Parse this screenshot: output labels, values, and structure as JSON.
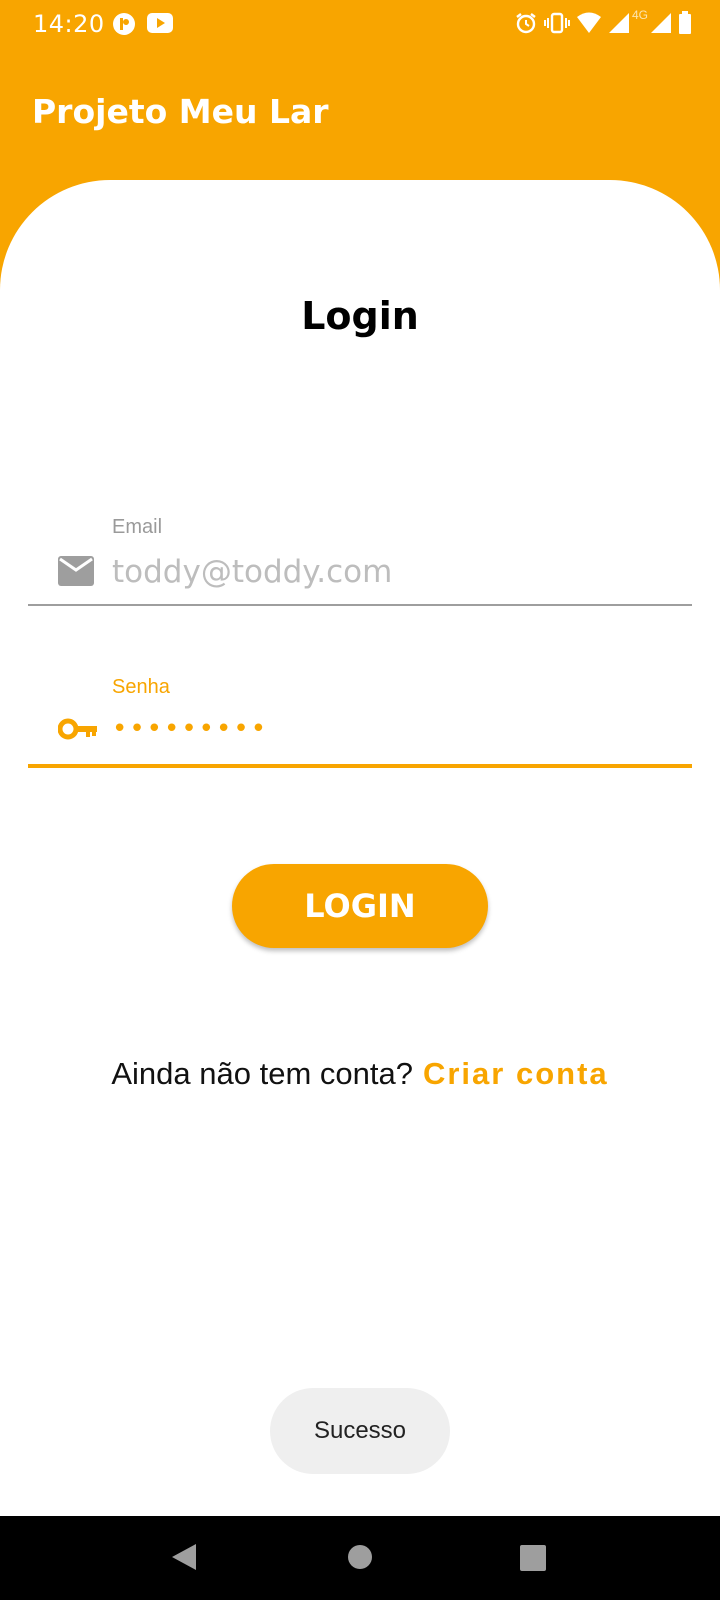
{
  "status_bar": {
    "time": "14:20",
    "left_icons": [
      "notification-app-icon",
      "youtube-icon"
    ],
    "right_icons": [
      "alarm-icon",
      "vibrate-icon",
      "wifi-icon",
      "signal-icon",
      "signal-icon",
      "battery-icon"
    ],
    "network_label": "4G"
  },
  "app_bar": {
    "title": "Projeto Meu Lar"
  },
  "login": {
    "heading": "Login",
    "email": {
      "label": "Email",
      "placeholder": "toddy@toddy.com",
      "value": ""
    },
    "password": {
      "label": "Senha",
      "value": "•••••••••"
    },
    "login_button_label": "LOGIN",
    "signup_prompt": "Ainda não tem conta?",
    "signup_link_label": "Criar conta"
  },
  "toast": {
    "message": "Sucesso"
  },
  "colors": {
    "accent": "#F8A500",
    "background": "#FFFFFF",
    "nav_bar": "#000000"
  }
}
